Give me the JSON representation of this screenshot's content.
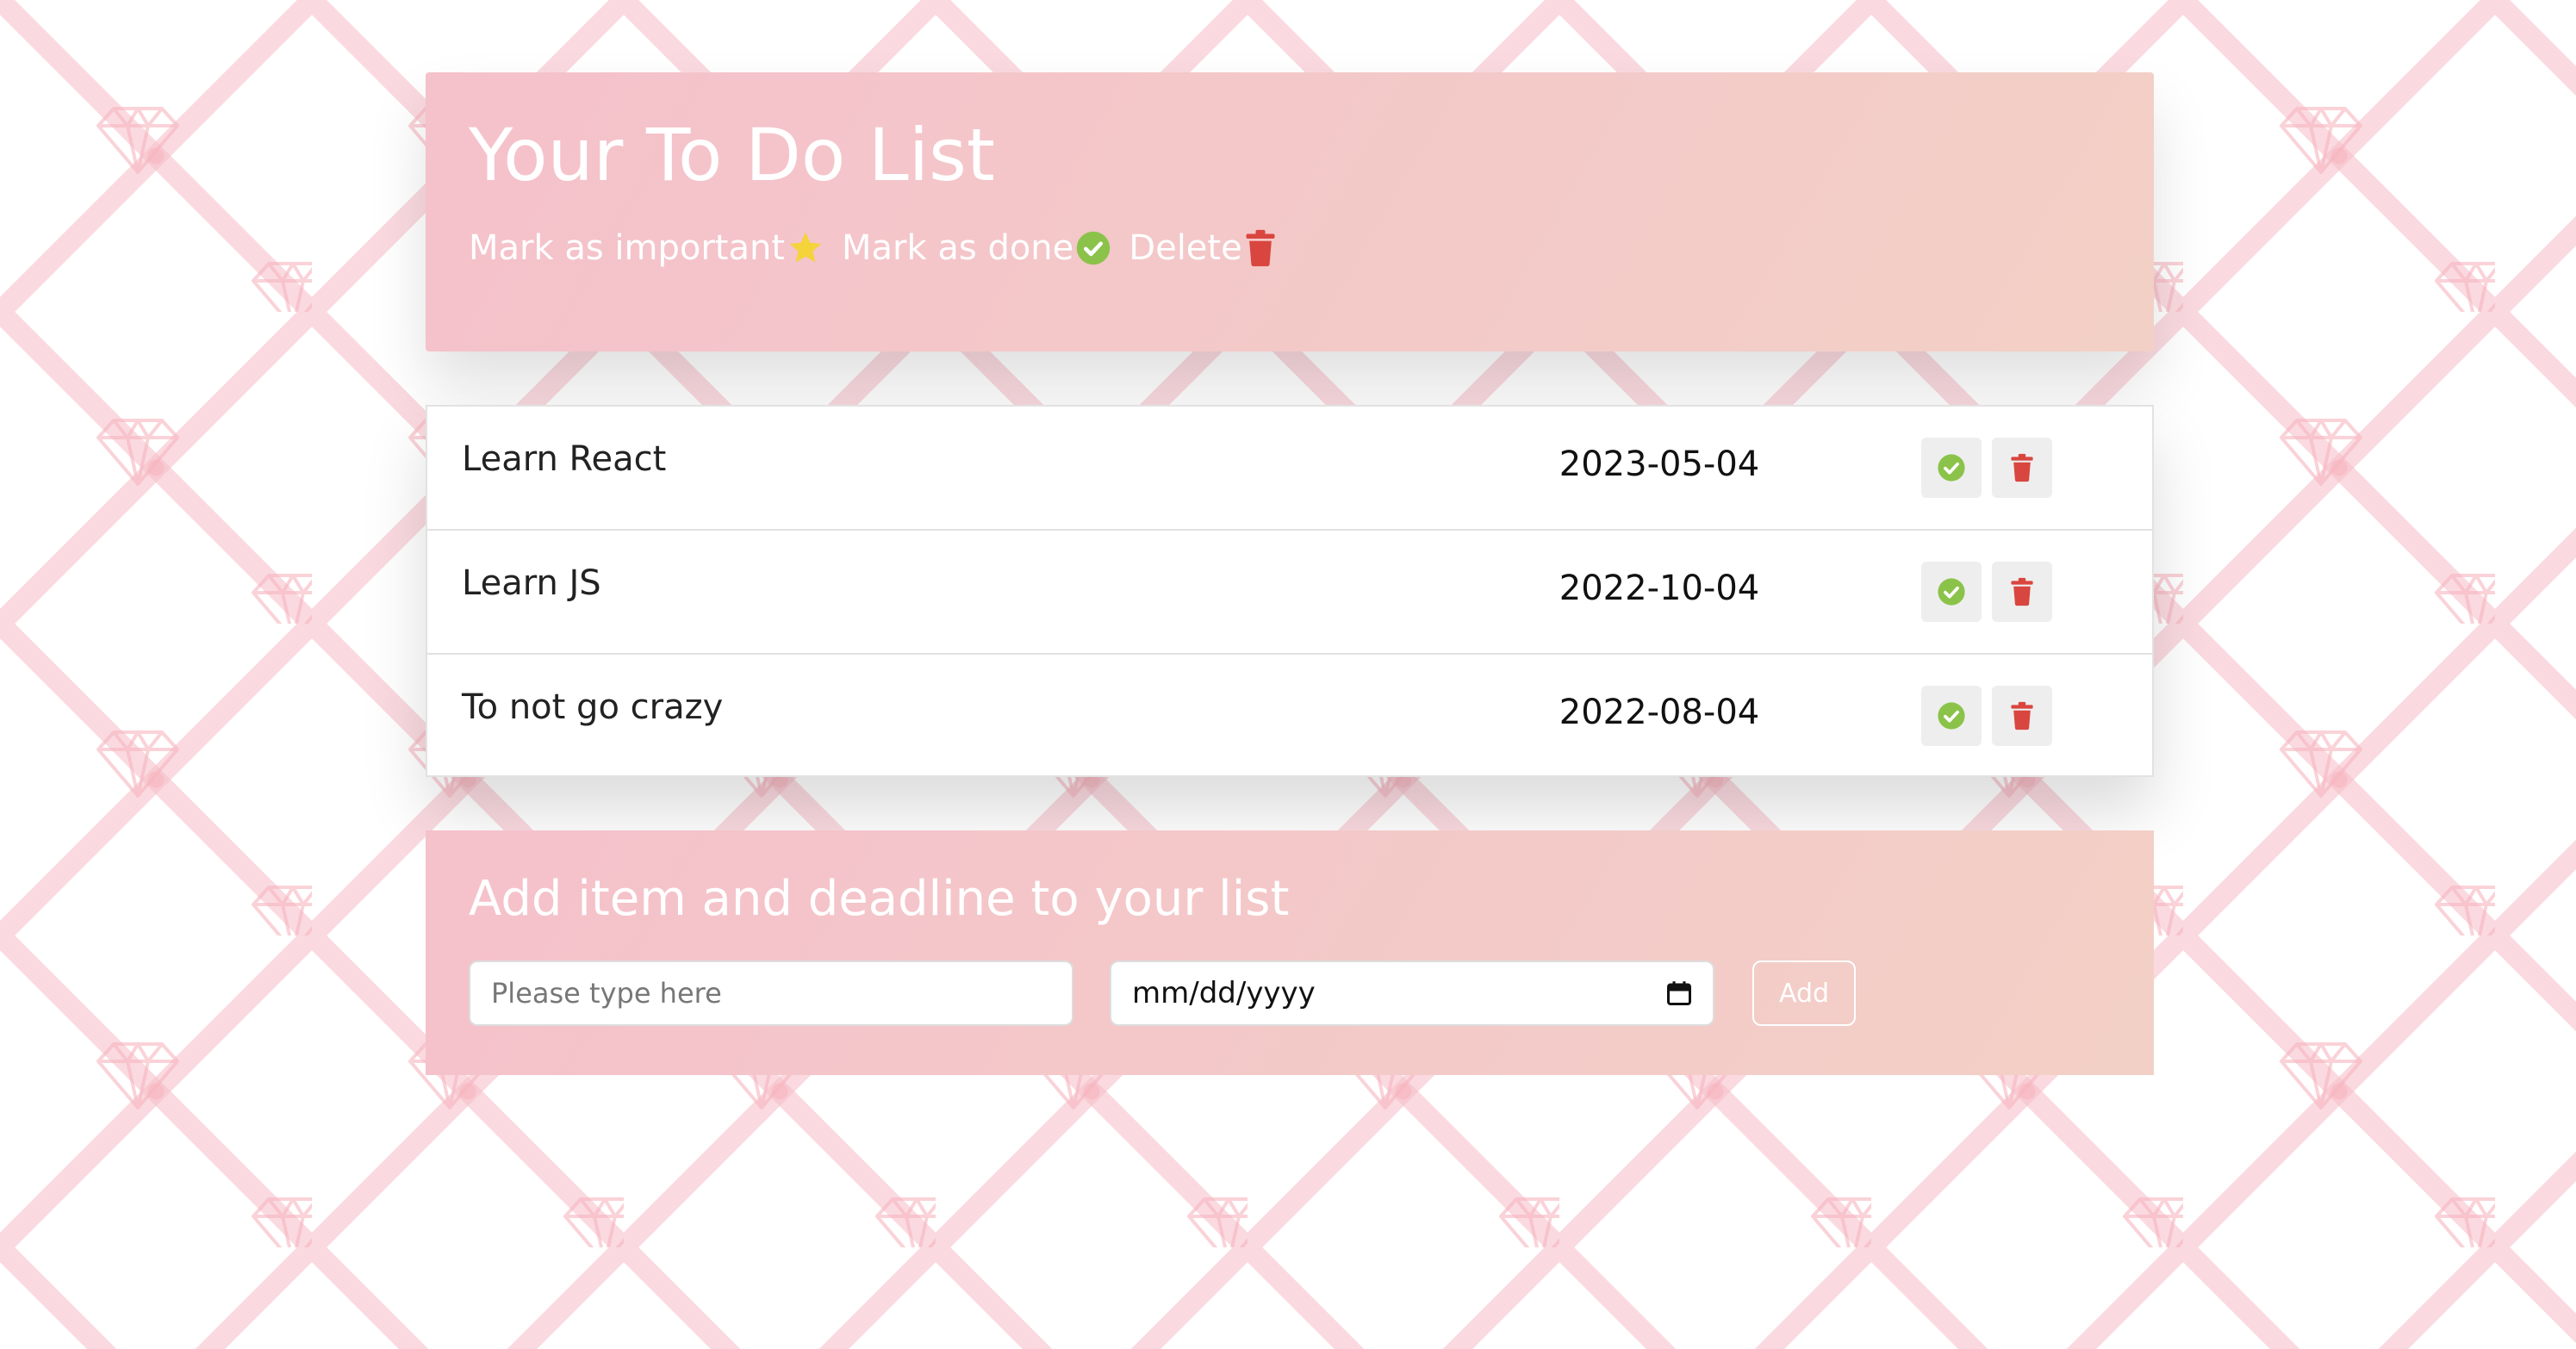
{
  "header": {
    "title": "Your To Do List",
    "legend": [
      {
        "label": "Mark as important",
        "icon": "star-icon",
        "color": "#f5d33a"
      },
      {
        "label": "Mark as done",
        "icon": "check-circle-icon",
        "color": "#8bc34a"
      },
      {
        "label": "Delete",
        "icon": "trash-icon",
        "color": "#d9463f"
      }
    ]
  },
  "todos": [
    {
      "task": "Learn React",
      "deadline": "2023-05-04"
    },
    {
      "task": "Learn JS",
      "deadline": "2022-10-04"
    },
    {
      "task": "To not go crazy",
      "deadline": "2022-08-04"
    }
  ],
  "add_form": {
    "title": "Add item and deadline to your list",
    "task_placeholder": "Please type here",
    "date_placeholder": "mm/dd/yyyy",
    "add_label": "Add"
  },
  "colors": {
    "accent_pink": "#f5c1cb",
    "done_green": "#8bc34a",
    "delete_red": "#d9463f",
    "star_yellow": "#f5d33a"
  }
}
